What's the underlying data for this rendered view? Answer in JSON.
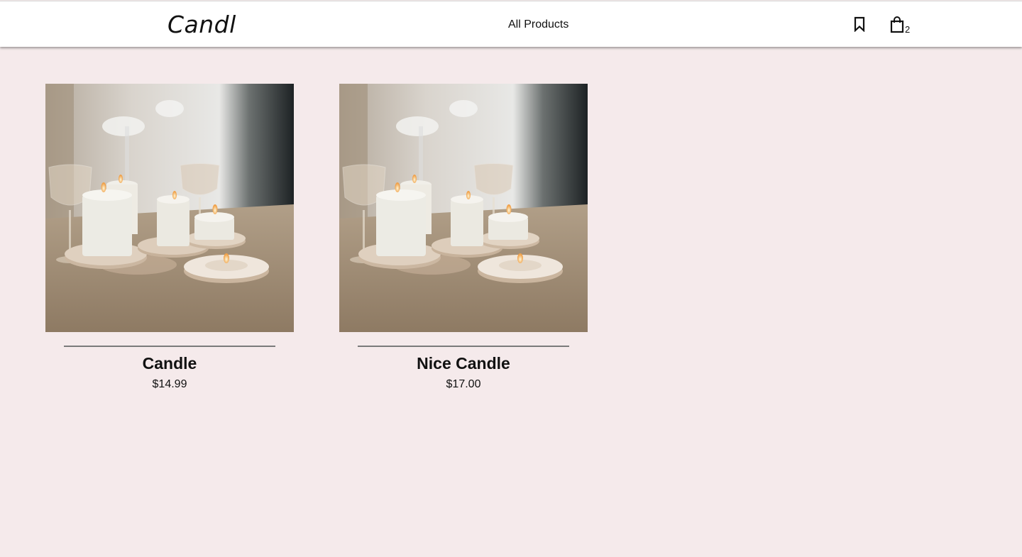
{
  "header": {
    "logo": "Candl",
    "nav_link": "All Products",
    "bookmark_icon": "bookmark-icon",
    "cart_icon": "shopping-bag-icon",
    "cart_count": "2"
  },
  "products": [
    {
      "name": "Candle",
      "price": "$14.99",
      "image": "candles-on-wooden-table-photo"
    },
    {
      "name": "Nice Candle",
      "price": "$17.00",
      "image": "candles-on-wooden-table-photo"
    }
  ],
  "colors": {
    "page_background": "#f5eaeb",
    "header_background": "#ffffff",
    "text": "#111111",
    "divider": "#7a7a7a"
  }
}
